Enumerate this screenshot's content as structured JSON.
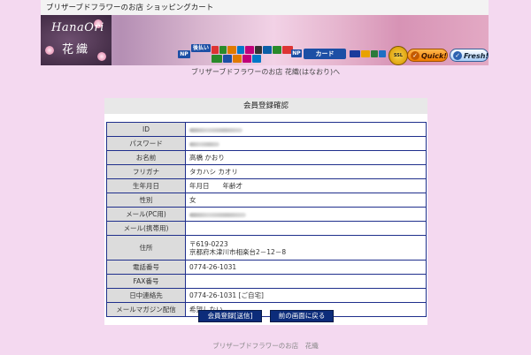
{
  "header": {
    "shop_title": "ブリザーブドフラワーのお店 ショッピングカート",
    "logo_text_en": "HanaOri",
    "logo_text_jp": "花織",
    "payment_badge_text": "後払い",
    "card_badge_text": "カード",
    "card_logos": [
      "VISA",
      "MC",
      "JCB",
      "AMEX",
      "DC"
    ],
    "ssl_text": "SSL",
    "quick_label": "Quick!",
    "fresh_label": "Fresh!"
  },
  "breadcrumb": "ブリザーブドフラワーのお店 花織(はなおり)へ",
  "form": {
    "title": "会員登録確認",
    "rows": [
      {
        "label": "ID",
        "value": ""
      },
      {
        "label": "パスワード",
        "value": ""
      },
      {
        "label": "お名前",
        "value": "高橋 かおり"
      },
      {
        "label": "フリガナ",
        "value": "タカハシ カオリ"
      },
      {
        "label": "生年月日",
        "value": "年月日　　年齢才"
      },
      {
        "label": "性別",
        "value": "女"
      },
      {
        "label": "メール(PC用)",
        "value": ""
      },
      {
        "label": "メール(携帯用)",
        "value": ""
      },
      {
        "label": "住所",
        "value": "〒619-0223",
        "value2": "京都府木津川市相楽台2－12－8"
      },
      {
        "label": "電話番号",
        "value": "0774-26-1031"
      },
      {
        "label": "FAX番号",
        "value": ""
      },
      {
        "label": "日中連絡先",
        "value": "0774-26-1031 [ご自宅]"
      },
      {
        "label": "メールマガジン配信",
        "value": "希望しない"
      }
    ]
  },
  "buttons": {
    "submit": "会員登録[送信]",
    "back": "前の画面に戻る"
  },
  "footer": "ブリザーブドフラワーのお店　花織",
  "colors": {
    "page_background": "#f4d9f0",
    "table_border": "#1f2f8c",
    "button_background": "#0c2c7a"
  }
}
